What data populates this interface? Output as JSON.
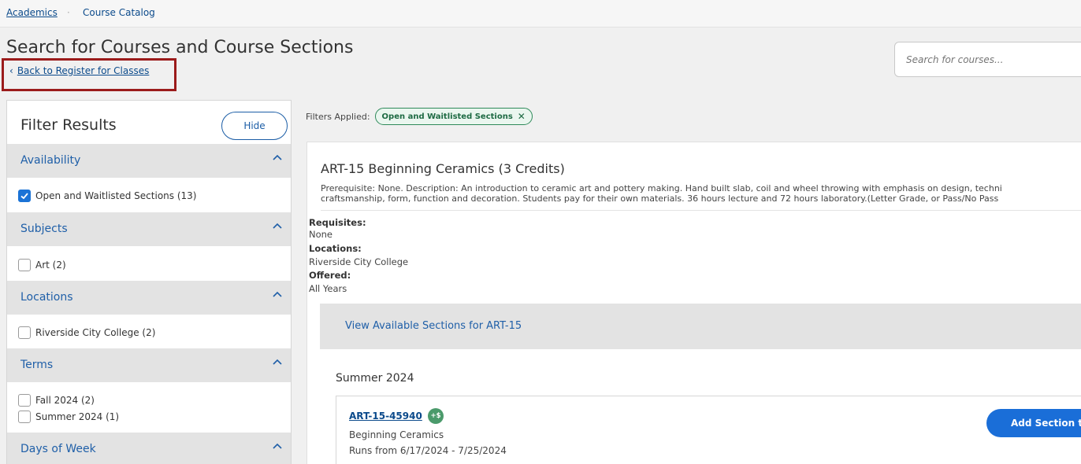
{
  "breadcrumb": {
    "root": "Academics",
    "separator": "·",
    "current": "Course Catalog"
  },
  "header": {
    "title": "Search for Courses and Course Sections",
    "back_link": "Back to Register for Classes"
  },
  "search": {
    "placeholder": "Search for courses..."
  },
  "filters": {
    "title": "Filter Results",
    "hide_label": "Hide",
    "sections": [
      {
        "label": "Availability",
        "expanded": true,
        "options": [
          {
            "label": "Open and Waitlisted Sections (13)",
            "checked": true
          }
        ]
      },
      {
        "label": "Subjects",
        "expanded": true,
        "options": [
          {
            "label": "Art (2)",
            "checked": false
          }
        ]
      },
      {
        "label": "Locations",
        "expanded": true,
        "options": [
          {
            "label": "Riverside City College (2)",
            "checked": false
          }
        ]
      },
      {
        "label": "Terms",
        "expanded": true,
        "options": [
          {
            "label": "Fall 2024 (2)",
            "checked": false
          },
          {
            "label": "Summer 2024 (1)",
            "checked": false
          }
        ]
      },
      {
        "label": "Days of Week",
        "expanded": true,
        "options": []
      }
    ]
  },
  "applied": {
    "label": "Filters Applied:",
    "chips": [
      "Open and Waitlisted Sections"
    ]
  },
  "course": {
    "title": "ART-15 Beginning Ceramics (3 Credits)",
    "description_line1": "Prerequisite: None. Description: An introduction to ceramic art and pottery making. Hand built slab, coil and wheel throwing with emphasis on design, techni",
    "description_line2": "craftsmanship, form, function and decoration. Students pay for their own materials. 36 hours lecture and 72 hours laboratory.(Letter Grade, or Pass/No Pass",
    "requisites_label": "Requisites:",
    "requisites_value": "None",
    "locations_label": "Locations:",
    "locations_value": "Riverside City College",
    "offered_label": "Offered:",
    "offered_value": "All Years",
    "sections_link": "View Available Sections for ART-15",
    "term": "Summer 2024",
    "section": {
      "id": "ART-15-45940",
      "fee_badge": "+$",
      "name": "Beginning Ceramics",
      "runs": "Runs from 6/17/2024 - 7/25/2024",
      "add_label": "Add Section to"
    }
  },
  "colors": {
    "link": "#0b4a8b",
    "accent": "#1a6ed8",
    "highlight_box": "#9b1b1b",
    "chip": "#2e8a5a"
  }
}
